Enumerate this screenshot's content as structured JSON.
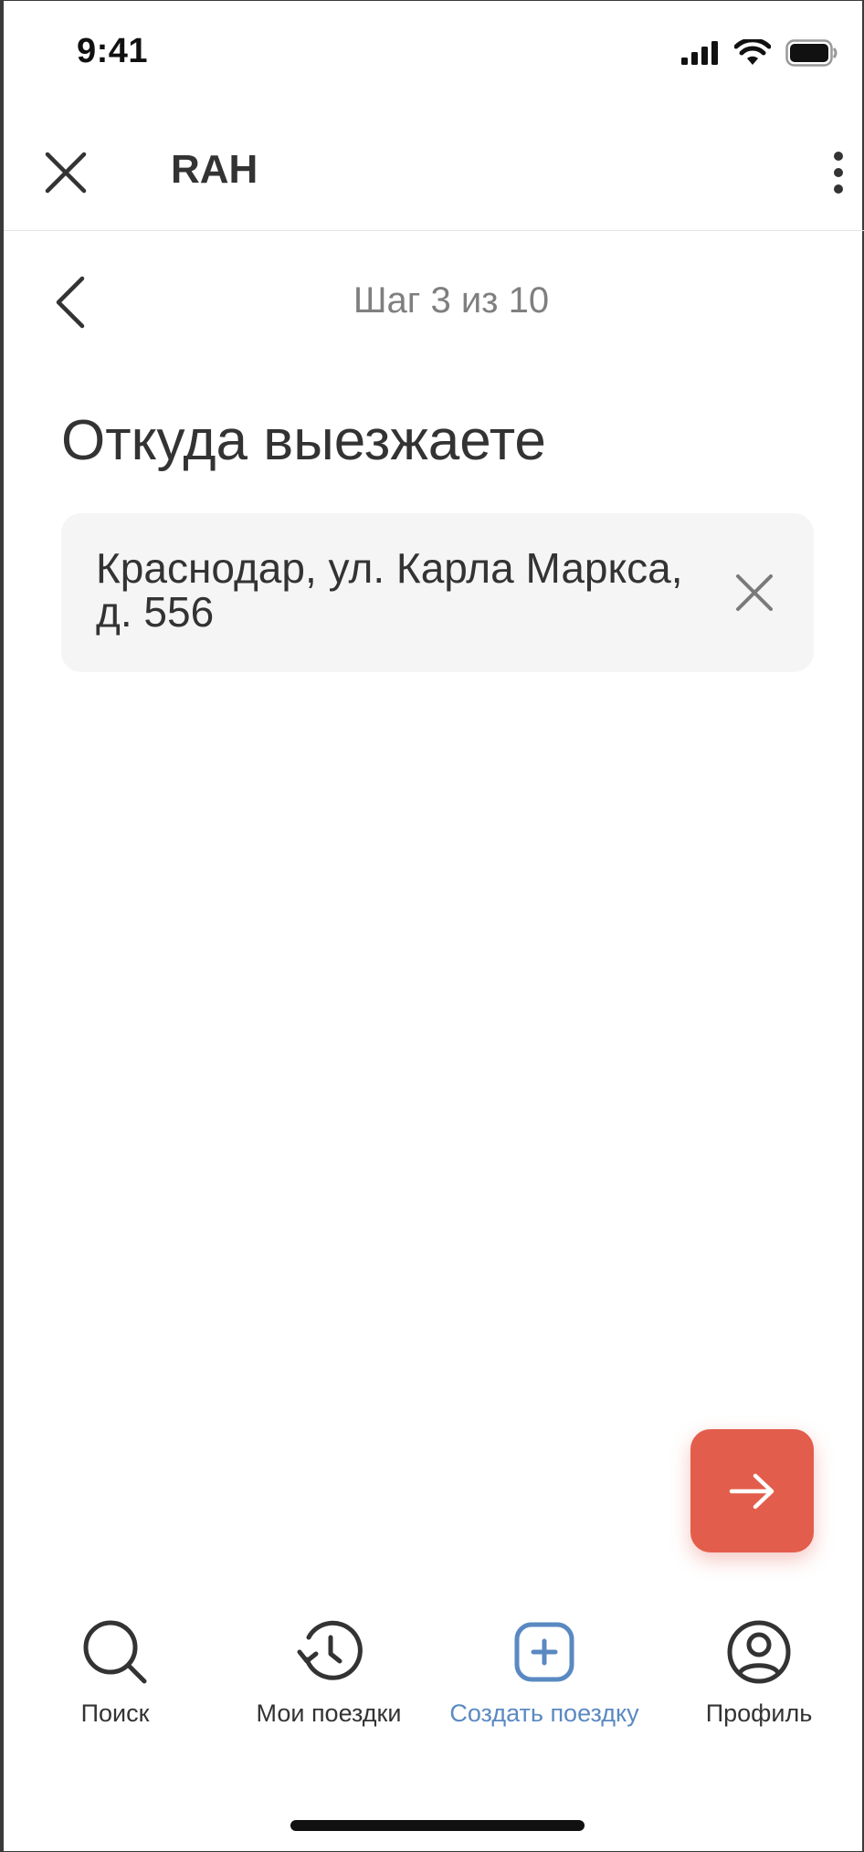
{
  "status_bar": {
    "time": "9:41"
  },
  "header": {
    "title": "RAH"
  },
  "step": {
    "text": "Шаг 3 из 10"
  },
  "page": {
    "title": "Откуда выезжаете"
  },
  "address": {
    "value": "Краснодар, ул. Карла Маркса, д. 556"
  },
  "tabs": [
    {
      "label": "Поиск",
      "icon": "search-icon",
      "active": false
    },
    {
      "label": "Мои поездки",
      "icon": "history-icon",
      "active": false
    },
    {
      "label": "Создать поездку",
      "icon": "add-square-icon",
      "active": true
    },
    {
      "label": "Профиль",
      "icon": "profile-icon",
      "active": false
    }
  ],
  "colors": {
    "accent": "#e35d4c",
    "active_tab": "#5a89c2",
    "text": "#333333",
    "muted": "#7f7f7f",
    "field_bg": "#f5f5f5"
  }
}
